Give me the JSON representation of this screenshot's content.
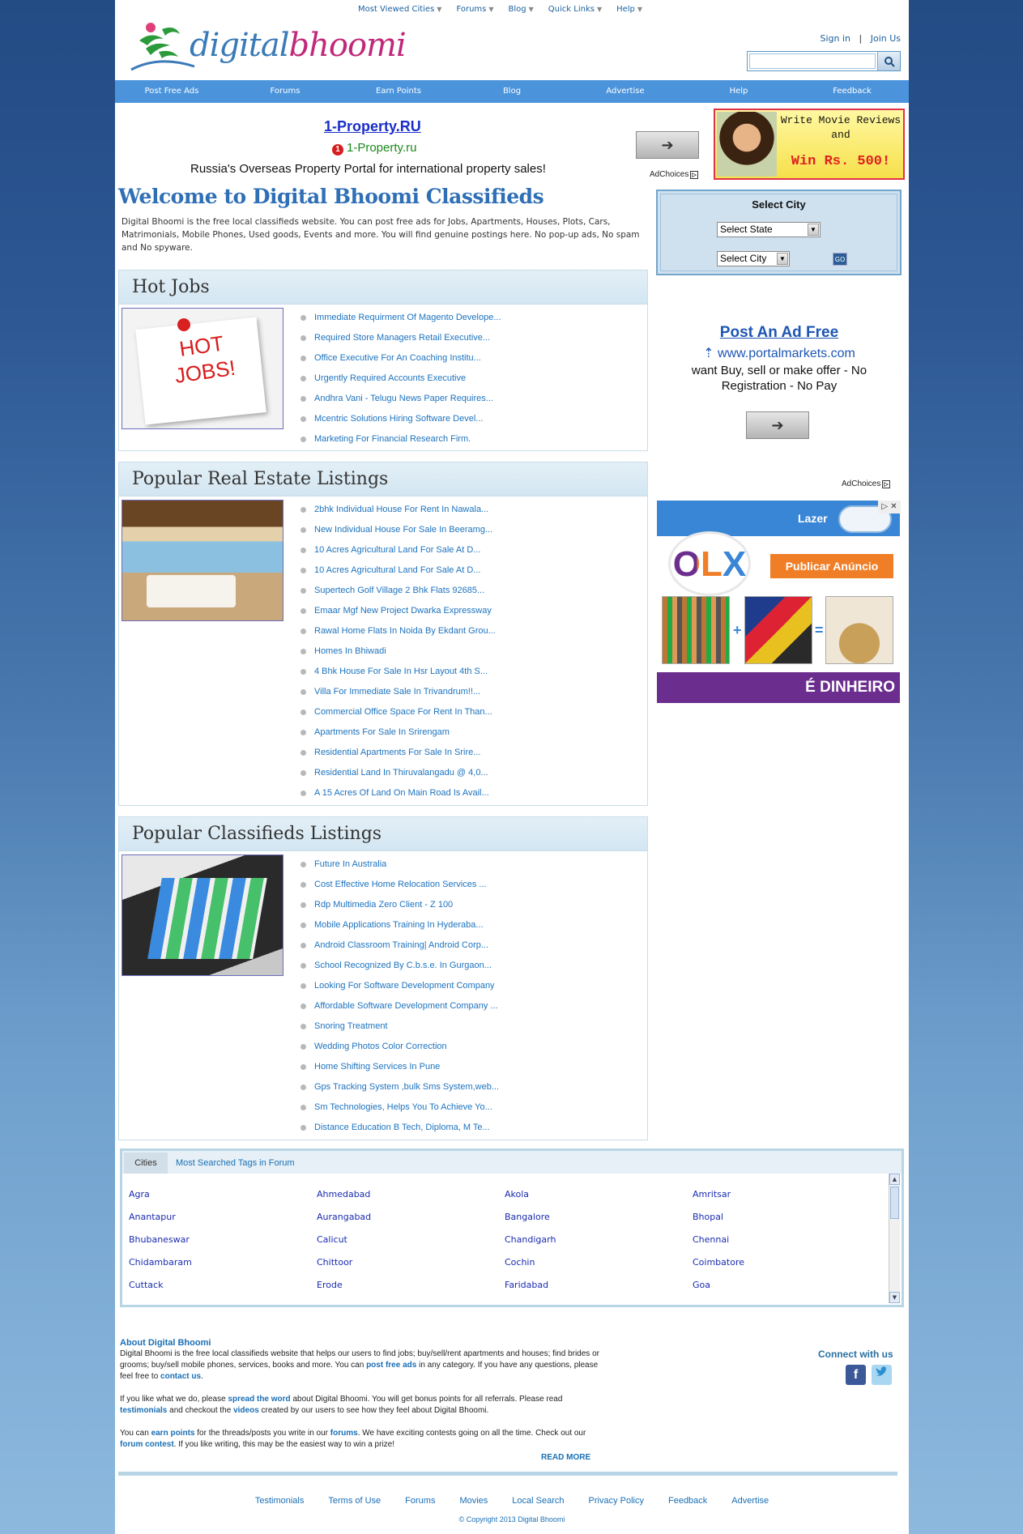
{
  "header": {
    "top_nav": [
      "Most Viewed Cities",
      "Forums",
      "Blog",
      "Quick Links",
      "Help"
    ],
    "logo_digital": "digital",
    "logo_bhoomi": "bhoomi",
    "sign_in": "Sign in",
    "separator": "|",
    "join_us": "Join Us",
    "search_placeholder": ""
  },
  "main_nav": [
    "Post Free Ads",
    "Forums",
    "Earn Points",
    "Blog",
    "Advertise",
    "Help",
    "Feedback"
  ],
  "ad_top": {
    "title": "1-Property.RU",
    "badge": "1",
    "url": "1-Property.ru",
    "description": "Russia's Overseas Property Portal for international property sales!",
    "adchoices": "AdChoices",
    "adchoices_icon": "▷"
  },
  "movie_ad": {
    "line1": "Write Movie Reviews and",
    "line2": "Win Rs. 500!"
  },
  "welcome": {
    "title": "Welcome to Digital Bhoomi Classifieds",
    "intro": "Digital Bhoomi is the free local classifieds website. You can post free ads for Jobs, Apartments, Houses, Plots, Cars, Matrimonials, Mobile Phones, Used goods, Events and more. You will find genuine postings here. No pop-up ads, No spam and No spyware."
  },
  "select_city": {
    "title": "Select City",
    "state_select": "Select State",
    "city_select": "Select City",
    "go": "GO"
  },
  "post_ad": {
    "title": "Post An Ad Free",
    "url": "www.portalmarkets.com",
    "description": "want Buy, sell or make offer - No Registration - No Pay",
    "adchoices": "AdChoices",
    "adchoices_icon": "▷"
  },
  "olx_ad": {
    "lazer": "Lazer",
    "logo": "OLX",
    "button": "Publicar Anúncio",
    "plus": "+",
    "equals": "=",
    "tagline": "É DINHEIRO",
    "close": "▷ ✕"
  },
  "hot_jobs": {
    "title": "Hot Jobs",
    "image_text": "HOT JOBS!",
    "items": [
      "Immediate Requirment Of Magento Develope...",
      "Required Store Managers Retail Executive...",
      "Office Executive For An Coaching Institu...",
      "Urgently Required Accounts Executive",
      "Andhra Vani - Telugu News Paper Requires...",
      "Mcentric Solutions Hiring Software Devel...",
      "Marketing For Financial Research Firm."
    ]
  },
  "real_estate": {
    "title": "Popular Real Estate Listings",
    "items": [
      "2bhk Individual House For Rent In Nawala...",
      "New Individual House For Sale In Beeramg...",
      "10 Acres Agricultural Land For Sale At D...",
      "10 Acres Agricultural Land For Sale At D...",
      "Supertech Golf Village 2 Bhk Flats 92685...",
      "Emaar Mgf New Project Dwarka Expressway",
      "Rawal Home Flats In Noida By Ekdant Grou...",
      "Homes In Bhiwadi",
      "4 Bhk House For Sale In Hsr Layout 4th S...",
      "Villa For Immediate Sale In Trivandrum!!...",
      "Commercial Office Space For Rent In Than...",
      "Apartments For Sale In Srirengam",
      "Residential Apartments For Sale In Srire...",
      "Residential Land In Thiruvalangadu @ 4,0...",
      "A 15 Acres Of Land On Main Road Is Avail..."
    ]
  },
  "classifieds": {
    "title": "Popular Classifieds Listings",
    "items": [
      "Future In Australia",
      "Cost Effective Home Relocation Services ...",
      "Rdp Multimedia Zero Client - Z 100",
      "Mobile Applications Training In Hyderaba...",
      "Android Classroom Training| Android Corp...",
      "School Recognized By C.b.s.e. In Gurgaon...",
      "Looking For Software Development Company",
      "Affordable Software Development Company ...",
      "Snoring Treatment",
      "Wedding Photos Color Correction",
      "Home Shifting Services In Pune",
      "Gps Tracking System ,bulk Sms System,web...",
      "Sm Technologies, Helps You To Achieve Yo...",
      "Distance Education B Tech, Diploma, M Te..."
    ]
  },
  "cities_box": {
    "tab_cities": "Cities",
    "tab_tags": "Most Searched Tags in Forum",
    "cities": [
      "Agra",
      "Ahmedabad",
      "Akola",
      "Amritsar",
      "Anantapur",
      "Aurangabad",
      "Bangalore",
      "Bhopal",
      "Bhubaneswar",
      "Calicut",
      "Chandigarh",
      "Chennai",
      "Chidambaram",
      "Chittoor",
      "Cochin",
      "Coimbatore",
      "Cuttack",
      "Erode",
      "Faridabad",
      "Goa"
    ]
  },
  "about": {
    "title": "About Digital Bhoomi",
    "p1_a": "Digital Bhoomi is the free local classifieds website that helps our users to find jobs; buy/sell/rent apartments and houses; find brides or grooms; buy/sell mobile phones, services, books and more. You can ",
    "p1_link1": "post free ads",
    "p1_b": " in any category. If you have any questions, please feel free to ",
    "p1_link2": "contact us",
    "p1_c": ".",
    "p2_a": "If you like what we do, please ",
    "p2_link1": "spread the word",
    "p2_b": " about Digital Bhoomi. You will get bonus points for all referrals. Please read ",
    "p2_link2": "testimonials",
    "p2_c": " and checkout the ",
    "p2_link3": "videos",
    "p2_d": " created by our users to see how they feel about Digital Bhoomi.",
    "p3_a": "You can ",
    "p3_link1": "earn points",
    "p3_b": " for the threads/posts you write in our ",
    "p3_link2": "forums",
    "p3_c": ". We have exciting contests going on all the time. Check out our ",
    "p3_link3": "forum contest",
    "p3_d": ". If you like writing, this may be the easiest way to win a prize!",
    "read_more": "READ MORE",
    "connect": "Connect with us"
  },
  "footer": {
    "links": [
      "Testimonials",
      "Terms of Use",
      "Forums",
      "Movies",
      "Local Search",
      "Privacy Policy",
      "Feedback",
      "Advertise"
    ],
    "copyright": "© Copyright 2013 Digital Bhoomi"
  }
}
